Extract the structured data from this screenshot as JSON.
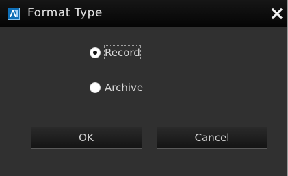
{
  "window": {
    "title": "Format Type",
    "icon": "app-logo-icon",
    "close_icon": "close-icon"
  },
  "options": [
    {
      "label": "Record",
      "selected": true
    },
    {
      "label": "Archive",
      "selected": false
    }
  ],
  "buttons": {
    "ok_label": "OK",
    "cancel_label": "Cancel"
  },
  "colors": {
    "dialog_background": "#303030",
    "titlebar_background": "#0a0a0a",
    "text": "#d6d6d6",
    "icon_accent": "#0e6fb8"
  }
}
